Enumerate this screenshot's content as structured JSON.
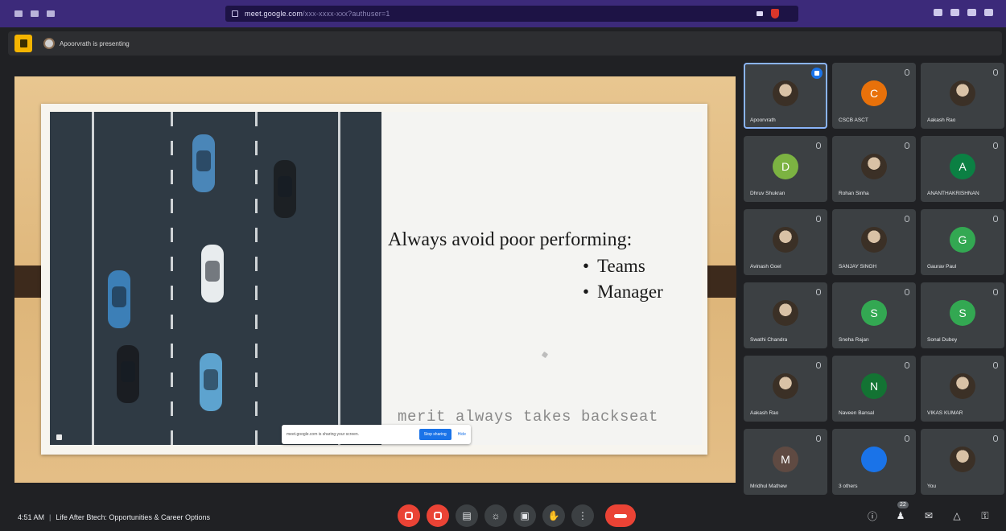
{
  "browser": {
    "url": "meet.google.com",
    "url_rest": "/xxx-xxxx-xxx?authuser=1"
  },
  "presenting": {
    "text": "Apoorvrath is presenting"
  },
  "slide": {
    "title": "Always avoid poor performing:",
    "bullets": [
      "Teams",
      "Manager"
    ],
    "tagline": "merit always takes backseat"
  },
  "share_notice": {
    "message": "meet.google.com is sharing your screen.",
    "stop_label": "Stop sharing",
    "hide_label": "Hide"
  },
  "participants": [
    {
      "name": "Apoorvrath",
      "initial": "",
      "color": "",
      "photo": true,
      "speaking": true
    },
    {
      "name": "CSCB ASCT",
      "initial": "C",
      "color": "#e8710a",
      "photo": false
    },
    {
      "name": "Aakash Rao",
      "initial": "",
      "color": "",
      "photo": true
    },
    {
      "name": "Dhruv Shukran",
      "initial": "D",
      "color": "#7cb342",
      "photo": false
    },
    {
      "name": "Rohan Sinha",
      "initial": "",
      "color": "",
      "photo": true
    },
    {
      "name": "ANANTHAKRISHNAN",
      "initial": "A",
      "color": "#0b8043",
      "photo": false
    },
    {
      "name": "Avinash Goel",
      "initial": "",
      "color": "",
      "photo": true
    },
    {
      "name": "SANJAY SINGH",
      "initial": "",
      "color": "",
      "photo": true
    },
    {
      "name": "Gaurav Paul",
      "initial": "G",
      "color": "#33a852",
      "photo": false
    },
    {
      "name": "Swathi Chandra",
      "initial": "",
      "color": "",
      "photo": true
    },
    {
      "name": "Sneha Rajan",
      "initial": "S",
      "color": "#33a852",
      "photo": false
    },
    {
      "name": "Sonal Dubey",
      "initial": "S",
      "color": "#33a852",
      "photo": false
    },
    {
      "name": "Aakash Rao",
      "initial": "",
      "color": "",
      "photo": true
    },
    {
      "name": "Naveen Bansal",
      "initial": "N",
      "color": "#137333",
      "photo": false
    },
    {
      "name": "VIKAS KUMAR",
      "initial": "",
      "color": "",
      "photo": true
    },
    {
      "name": "Mridhul Mathew",
      "initial": "M",
      "color": "#5f4a42",
      "photo": false
    },
    {
      "name": "3 others",
      "initial": "",
      "color": "#1a73e8",
      "photo": false
    },
    {
      "name": "You",
      "initial": "",
      "color": "",
      "photo": true
    }
  ],
  "meeting": {
    "time": "4:51 AM",
    "title": "Life After Btech: Opportunities & Career Options"
  },
  "people_count": "22",
  "colors": {
    "chrome": "#3c2a7a",
    "end_call": "#ea4335",
    "accent": "#1a73e8"
  }
}
